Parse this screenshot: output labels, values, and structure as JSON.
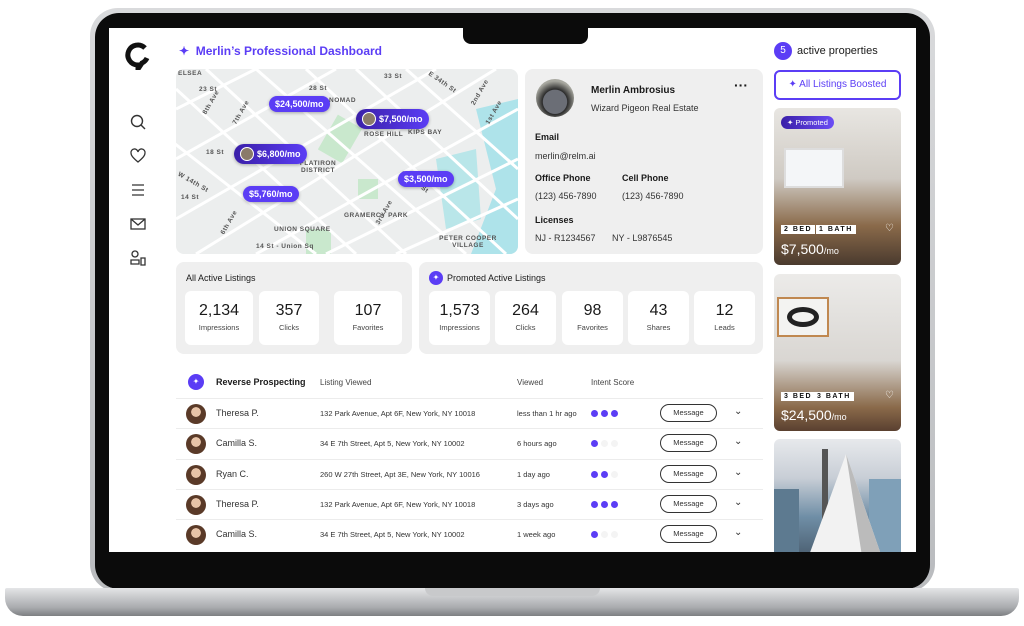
{
  "header": {
    "title": "Merlin’s Professional Dashboard",
    "active_count": "5",
    "active_label": "active properties",
    "boost_button": "All Listings Boosted"
  },
  "sidebar": {
    "items": [
      "search-icon",
      "heart-icon",
      "menu-icon",
      "mail-icon",
      "dashboard-icon"
    ]
  },
  "map": {
    "pins": [
      "$24,500/mo",
      "$7,500/mo",
      "$6,800/mo",
      "$5,760/mo",
      "$3,500/mo"
    ],
    "labels": [
      "ELSEA",
      "NOMAD",
      "ROSE HILL",
      "KIPS BAY",
      "FLATIRON DISTRICT",
      "GRAMERCY PARK",
      "UNION SQUARE",
      "PETER COOPER VILLAGE",
      "23 St",
      "28 St",
      "33 St",
      "18 St",
      "14 St",
      "14 St - Union Sq",
      "E 34th St",
      "E 23rd St",
      "3rd Ave",
      "2nd Ave",
      "1st Ave",
      "7th Ave",
      "8th Ave",
      "6th Ave",
      "W 14th St"
    ]
  },
  "profile": {
    "name": "Merlin Ambrosius",
    "company": "Wizard Pigeon Real Estate",
    "email_label": "Email",
    "email": "merlin@relm.ai",
    "office_label": "Office Phone",
    "office": "(123) 456-7890",
    "cell_label": "Cell Phone",
    "cell": "(123) 456-7890",
    "licenses_label": "Licenses",
    "license_nj": "NJ - R1234567",
    "license_ny": "NY - L9876545"
  },
  "all_listings": {
    "title": "All Active Listings",
    "stats": [
      {
        "n": "2,134",
        "l": "Impressions"
      },
      {
        "n": "357",
        "l": "Clicks"
      },
      {
        "n": "107",
        "l": "Favorites"
      }
    ]
  },
  "promoted": {
    "title": "Promoted Active Listings",
    "stats": [
      {
        "n": "1,573",
        "l": "Impressions"
      },
      {
        "n": "264",
        "l": "Clicks"
      },
      {
        "n": "98",
        "l": "Favorites"
      },
      {
        "n": "43",
        "l": "Shares"
      },
      {
        "n": "12",
        "l": "Leads"
      }
    ]
  },
  "prospecting": {
    "title": "Reverse Prospecting",
    "col_listing": "Listing Viewed",
    "col_viewed": "Viewed",
    "col_intent": "Intent Score",
    "message_label": "Message",
    "rows": [
      {
        "name": "Theresa P.",
        "address": "132 Park Avenue, Apt 6F, New York, NY 10018",
        "viewed": "less than 1 hr ago",
        "intent": 3
      },
      {
        "name": "Camilla S.",
        "address": "34 E 7th Street, Apt 5, New York, NY 10002",
        "viewed": "6 hours ago",
        "intent": 1
      },
      {
        "name": "Ryan C.",
        "address": "260 W 27th Street, Apt 3E, New York, NY 10016",
        "viewed": "1 day ago",
        "intent": 2
      },
      {
        "name": "Theresa P.",
        "address": "132 Park Avenue, Apt 6F, New York, NY 10018",
        "viewed": "3 days ago",
        "intent": 3
      },
      {
        "name": "Camilla S.",
        "address": "34 E 7th Street, Apt 5, New York, NY 10002",
        "viewed": "1 week ago",
        "intent": 1
      }
    ]
  },
  "properties": [
    {
      "promoted": "Promoted",
      "bed": "2 BED",
      "bath": "1 BATH",
      "price": "$7,500",
      "unit": "/mo"
    },
    {
      "bed": "3 BED",
      "bath": "3 BATH",
      "price": "$24,500",
      "unit": "/mo"
    }
  ],
  "colors": {
    "accent": "#5b3df5"
  }
}
